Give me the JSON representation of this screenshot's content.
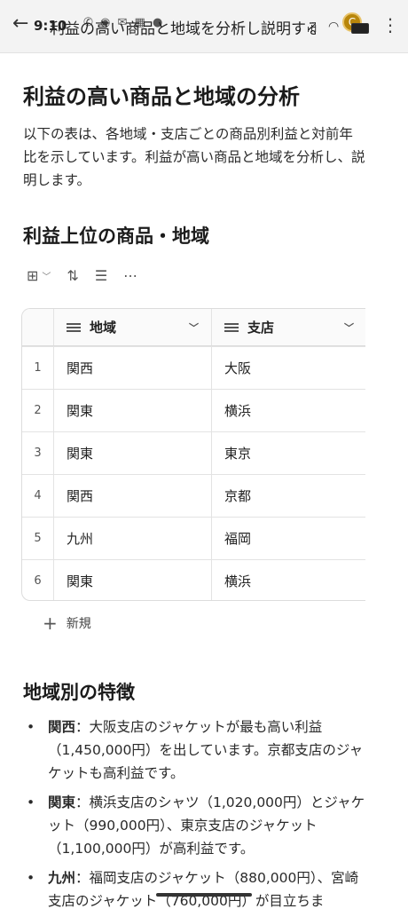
{
  "topbar": {
    "time": "9:10",
    "status_icons": "✆ ◉ ✉ ▦ ●",
    "title": "利益の高い商品と地域を分析し説明する",
    "signal": "ıll",
    "wifi": "◠",
    "avatar_letter": "C"
  },
  "doc": {
    "heading": "利益の高い商品と地域の分析",
    "intro": "以下の表は、各地域・支店ごとの商品別利益と対前年比を示しています。利益が高い商品と地域を分析し、説明します。"
  },
  "section_top": {
    "heading": "利益上位の商品・地域"
  },
  "table": {
    "columns": [
      "地域",
      "支店"
    ],
    "rows": [
      {
        "num": "1",
        "region": "関西",
        "branch": "大阪"
      },
      {
        "num": "2",
        "region": "関東",
        "branch": "横浜"
      },
      {
        "num": "3",
        "region": "関東",
        "branch": "東京"
      },
      {
        "num": "4",
        "region": "関西",
        "branch": "京都"
      },
      {
        "num": "5",
        "region": "九州",
        "branch": "福岡"
      },
      {
        "num": "6",
        "region": "関東",
        "branch": "横浜"
      }
    ],
    "new_label": "新規"
  },
  "section_region": {
    "heading": "地域別の特徴",
    "items": [
      {
        "label": "関西",
        "text": "：大阪支店のジャケットが最も高い利益（1,450,000円）を出しています。京都支店のジャケットも高利益です。"
      },
      {
        "label": "関東",
        "text": "：横浜支店のシャツ（1,020,000円）とジャケット（990,000円）、東京支店のジャケット（1,100,000円）が高利益です。"
      },
      {
        "label": "九州",
        "text": "：福岡支店のジャケット（880,000円）、宮崎支店のジャケット（760,000円）が目立ちま"
      }
    ]
  }
}
